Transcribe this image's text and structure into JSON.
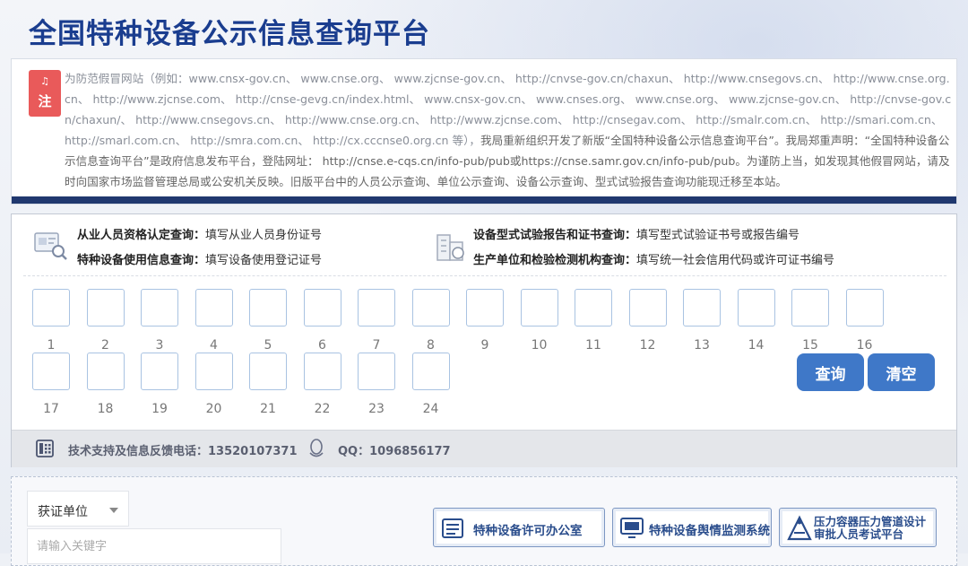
{
  "page": {
    "title": "全国特种设备公示信息查询平台"
  },
  "notice": {
    "badge": "注",
    "text_lead": "为防范假冒网站（例如：",
    "fake_sites": "www.cnsx-gov.cn、 www.cnse.org、 www.zjcnse-gov.cn、 http://cnvse-gov.cn/chaxun、 http://www.cnsegovs.cn、 http://www.cnse.org.cn、 http://www.zjcnse.com、 http://cnse-gevg.cn/index.html、 www.cnsx-gov.cn、 www.cnses.org、 www.cnse.org、 www.zjcnse-gov.cn、 http://cnvse-gov.cn/chaxun/、 http://www.cnsegovs.cn、 http://www.cnse.org.cn、 http://www.zjcnse.com、 http://cnsegav.com、 http://smalr.com.cn、 http://smari.com.cn、 http://smarl.com.cn、 http://smra.com.cn、 http://cx.cccnse0.org.cn 等），",
    "statement": "我局重新组织开发了新版“全国特种设备公示信息查询平台”。我局郑重声明：“全国特种设备公示信息查询平台”是政府信息发布平台，登陆网址： http://cnse.e-cqs.cn/info-pub/pub或https://cnse.samr.gov.cn/info-pub/pub。为谨防上当，如发现其他假冒网站，请及时向国家市场监督管理总局或公安机关反映。旧版平台中的人员公示查询、单位公示查询、设备公示查询、型式试验报告查询功能现迁移至本站。"
  },
  "query_types": {
    "personnel": {
      "label": "从业人员资格认定查询：",
      "hint": "填写从业人员身份证号"
    },
    "equipment_use": {
      "label": "特种设备使用信息查询：",
      "hint": "填写设备使用登记证号"
    },
    "type_test": {
      "label": "设备型式试验报告和证书查询：",
      "hint": "填写型式试验证书号或报告编号"
    },
    "manufacturer": {
      "label": "生产单位和检验检测机构查询：",
      "hint": "填写统一社会信用代码或许可证书编号"
    }
  },
  "cells": {
    "labels": [
      "1",
      "2",
      "3",
      "4",
      "5",
      "6",
      "7",
      "8",
      "9",
      "10",
      "11",
      "12",
      "13",
      "14",
      "15",
      "16",
      "17",
      "18",
      "19",
      "20",
      "21",
      "22",
      "23",
      "24"
    ]
  },
  "buttons": {
    "query": "查询",
    "clear": "清空"
  },
  "support": {
    "phone_text": "技术支持及信息反馈电话：13520107371",
    "qq_text": "QQ：1096856177"
  },
  "search": {
    "select_value": "获证单位",
    "keyword_placeholder": "请输入关键字"
  },
  "links": {
    "license_office": "特种设备许可办公室",
    "public_opinion": "特种设备舆情监测系统",
    "pressure_line1": "压力容器压力管道设计",
    "pressure_line2": "审批人员考试平台"
  },
  "colors": {
    "title": "#1a3d8f",
    "accent_bar": "#20386f",
    "button": "#3f78c8",
    "badge": "#e95a5a"
  }
}
